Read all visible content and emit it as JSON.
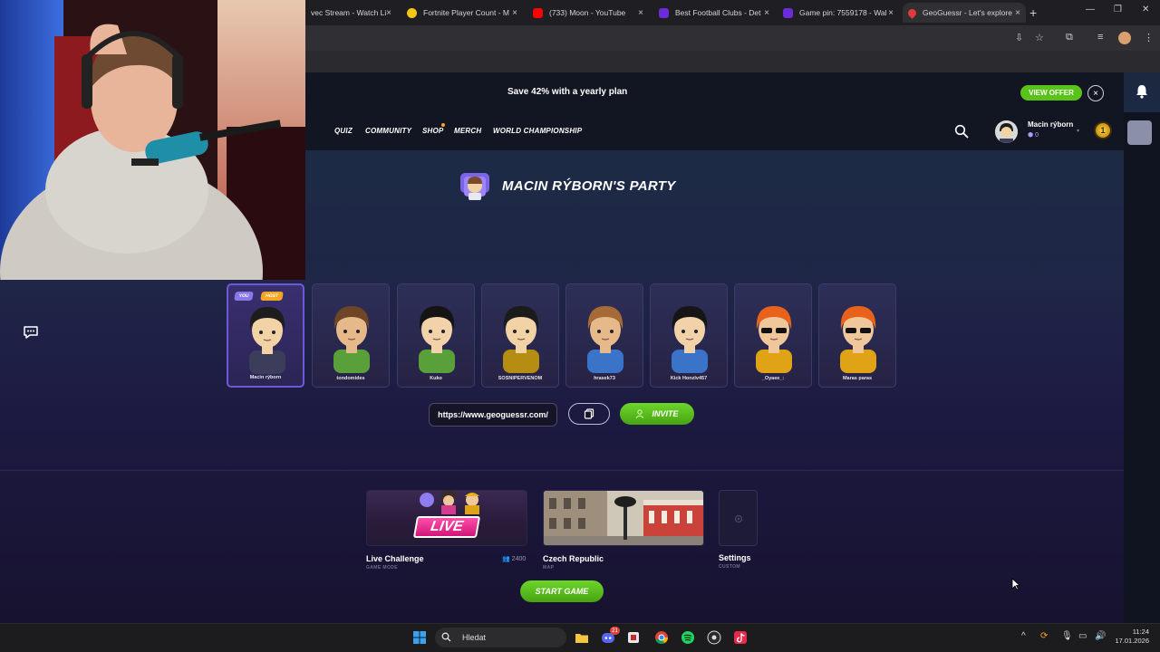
{
  "browser": {
    "tabs": [
      {
        "label": "vec Stream - Watch Li",
        "color": "#9146ff"
      },
      {
        "label": "Fortnite Player Count - M",
        "color": "#f5c518"
      },
      {
        "label": "(733) Moon - YouTube",
        "color": "#ff0000"
      },
      {
        "label": "Best Football Clubs - Det",
        "color": "#6b2bd9"
      },
      {
        "label": "Game pin: 7559178 - Wal",
        "color": "#6b2bd9"
      },
      {
        "label": "GeoGuessr - Let's explore",
        "color": "#e03a3a"
      }
    ],
    "new_tab": "+",
    "tab_close": "×"
  },
  "promo": {
    "text": "Save 42% with a yearly plan",
    "cta": "VIEW OFFER",
    "close": "×"
  },
  "nav": {
    "items": [
      "QUIZ",
      "COMMUNITY",
      "SHOP",
      "MERCH",
      "WORLD CHAMPIONSHIP"
    ]
  },
  "profile": {
    "name": "Macin rýborn",
    "badge": "0",
    "coin_level": "1"
  },
  "party": {
    "title": "MACIN RÝBORN'S PARTY",
    "badges": {
      "you": "YOU",
      "host": "HOST"
    },
    "players": [
      {
        "name": "Macin rýborn",
        "skin": "#f1d3a6",
        "hair": "#1d1d1d",
        "shirt": "#3c3d5a"
      },
      {
        "name": "tondomides",
        "skin": "#e6b98b",
        "hair": "#6e4526",
        "shirt": "#5aa03a"
      },
      {
        "name": "Kuko",
        "skin": "#f2d2a8",
        "hair": "#141414",
        "shirt": "#5aa03a"
      },
      {
        "name": "SOSNIPERVENOM",
        "skin": "#f1d3a6",
        "hair": "#1b1b1b",
        "shirt": "#b58d12"
      },
      {
        "name": "hrasek73",
        "skin": "#e6b98b",
        "hair": "#a66a36",
        "shirt": "#3b73c9"
      },
      {
        "name": "Kick Honzlv457",
        "skin": "#f2d2a8",
        "hair": "#151515",
        "shirt": "#3b73c9"
      },
      {
        "name": "_Oyaee_:",
        "skin": "#f0c79a",
        "hair": "#e8621c",
        "shirt": "#e0a316"
      },
      {
        "name": "Maras paras",
        "skin": "#f0c79a",
        "hair": "#e8621c",
        "shirt": "#e0a316"
      }
    ],
    "invite_url": "https://www.geoguessr.com/",
    "invite_label": "INVITE"
  },
  "modes": [
    {
      "title": "Live Challenge",
      "sub": "GAME MODE",
      "banner": "LIVE",
      "players": "2400"
    },
    {
      "title": "Czech Republic",
      "sub": "MAP"
    },
    {
      "title": "Settings",
      "sub": "CUSTOM"
    }
  ],
  "start_label": "START GAME",
  "taskbar": {
    "search": "Hledat",
    "time": "11:24",
    "date": "17.01.2026",
    "discord_badge": "21"
  }
}
